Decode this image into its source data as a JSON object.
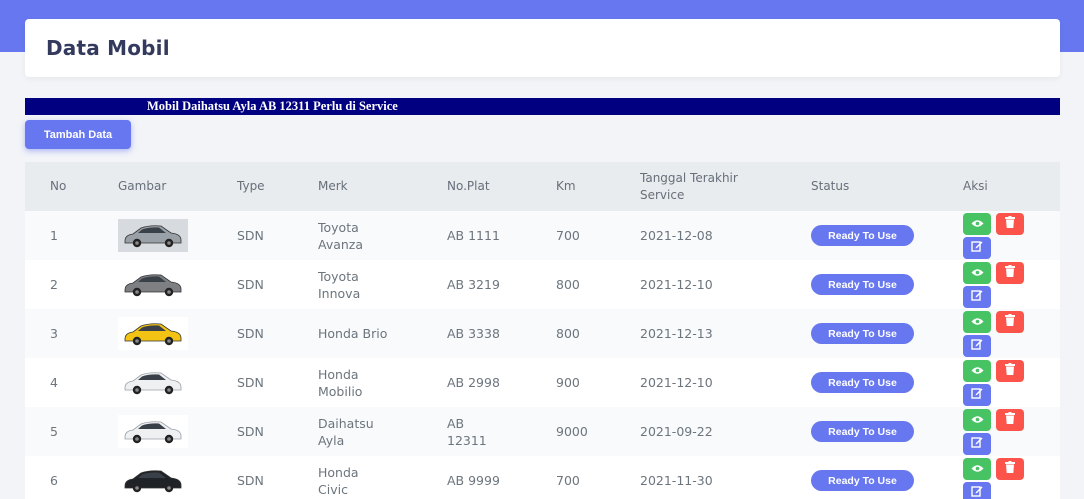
{
  "colors": {
    "primary": "#6777ef",
    "success": "#47c363",
    "danger": "#fc544b",
    "marquee_bg": "#000080"
  },
  "page": {
    "title": "Data Mobil"
  },
  "marquee": {
    "text": "Mobil Daihatsu Ayla AB 12311 Perlu di Service"
  },
  "toolbar": {
    "add_label": "Tambah Data"
  },
  "table": {
    "headers": {
      "no": "No",
      "image": "Gambar",
      "type": "Type",
      "brand": "Merk",
      "plate": "No.Plat",
      "km": "Km",
      "last_service": "Tanggal Terakhir Service",
      "status": "Status",
      "actions": "Aksi"
    },
    "rows": [
      {
        "no": "1",
        "type": "SDN",
        "brand": "Toyota Avanza",
        "plate": "AB 1111",
        "km": "700",
        "date": "2021-12-08",
        "status": "Ready To Use",
        "car_color": "silver",
        "thumb_bg": "gray"
      },
      {
        "no": "2",
        "type": "SDN",
        "brand": "Toyota Innova",
        "plate": "AB 3219",
        "km": "800",
        "date": "2021-12-10",
        "status": "Ready To Use",
        "car_color": "gray",
        "thumb_bg": "white"
      },
      {
        "no": "3",
        "type": "SDN",
        "brand": "Honda Brio",
        "plate": "AB 3338",
        "km": "800",
        "date": "2021-12-13",
        "status": "Ready To Use",
        "car_color": "yellow",
        "thumb_bg": "white"
      },
      {
        "no": "4",
        "type": "SDN",
        "brand": "Honda Mobilio",
        "plate": "AB 2998",
        "km": "900",
        "date": "2021-12-10",
        "status": "Ready To Use",
        "car_color": "white",
        "thumb_bg": "white"
      },
      {
        "no": "5",
        "type": "SDN",
        "brand": "Daihatsu Ayla",
        "plate": "AB 12311",
        "km": "9000",
        "date": "2021-09-22",
        "status": "Ready To Use",
        "car_color": "white",
        "thumb_bg": "white"
      },
      {
        "no": "6",
        "type": "SDN",
        "brand": "Honda Civic",
        "plate": "AB 9999",
        "km": "700",
        "date": "2021-11-30",
        "status": "Ready To Use",
        "car_color": "black",
        "thumb_bg": "white"
      }
    ]
  },
  "icons": {
    "view": "eye-icon",
    "delete": "trash-icon",
    "edit": "edit-icon"
  }
}
